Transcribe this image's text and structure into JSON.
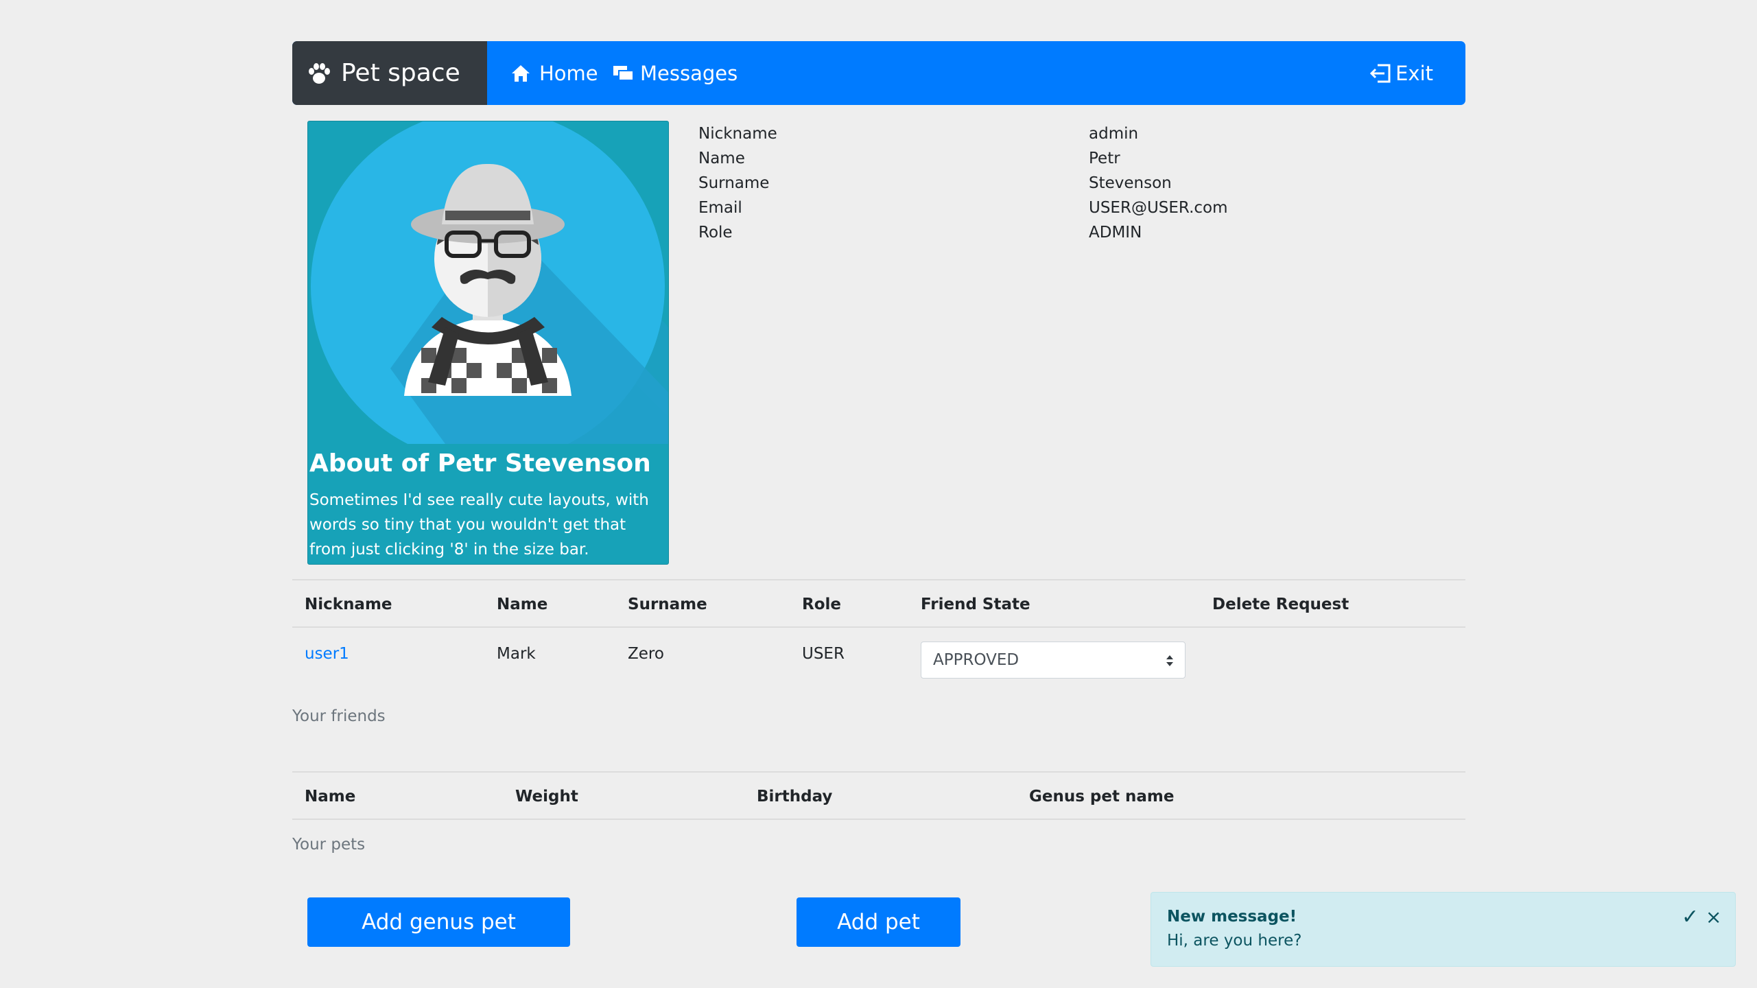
{
  "navbar": {
    "brand": "Pet space",
    "home": "Home",
    "messages": "Messages",
    "exit": "Exit"
  },
  "profile": {
    "about_title": "About of Petr Stevenson",
    "about_text": "Sometimes I'd see really cute layouts, with words so tiny that you wouldn't get that from just clicking '8' in the size bar.",
    "fields": [
      {
        "label": "Nickname",
        "value": "admin"
      },
      {
        "label": "Name",
        "value": "Petr"
      },
      {
        "label": "Surname",
        "value": "Stevenson"
      },
      {
        "label": "Email",
        "value": "USER@USER.com"
      },
      {
        "label": "Role",
        "value": "ADMIN"
      }
    ]
  },
  "friends_table": {
    "headers": [
      "Nickname",
      "Name",
      "Surname",
      "Role",
      "Friend State",
      "Delete Request"
    ],
    "rows": [
      {
        "nickname": "user1",
        "name": "Mark",
        "surname": "Zero",
        "role": "USER",
        "friend_state": "APPROVED"
      }
    ],
    "caption": "Your friends"
  },
  "pets_table": {
    "headers": [
      "Name",
      "Weight",
      "Birthday",
      "Genus pet name"
    ],
    "caption": "Your pets"
  },
  "buttons": {
    "add_genus_pet": "Add genus pet",
    "add_pet": "Add pet"
  },
  "toast": {
    "title": "New message!",
    "body": "Hi, are you here?",
    "check": "✓",
    "close": "×"
  },
  "colors": {
    "primary": "#007bff",
    "dark": "#343a40",
    "card": "#17a2b8",
    "toast_bg": "#d1ecf1",
    "toast_text": "#0c5460",
    "page_bg": "#eeeeee"
  }
}
